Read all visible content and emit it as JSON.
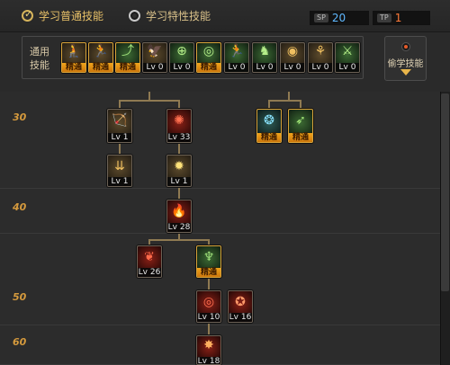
{
  "header": {
    "mode_normal": "学习普通技能",
    "mode_trait": "学习特性技能",
    "sp_tag": "SP",
    "sp_value": "20",
    "tp_tag": "TP",
    "tp_value": "1"
  },
  "common": {
    "label_line1": "通用",
    "label_line2": "技能",
    "mastered_text": "精通",
    "skills": [
      {
        "caption": "精通",
        "mastered": true
      },
      {
        "caption": "精通",
        "mastered": true
      },
      {
        "caption": "精通",
        "mastered": true
      },
      {
        "caption": "Lv 0",
        "mastered": false
      },
      {
        "caption": "Lv 0",
        "mastered": false
      },
      {
        "caption": "精通",
        "mastered": true
      },
      {
        "caption": "Lv 0",
        "mastered": false
      },
      {
        "caption": "Lv 0",
        "mastered": false
      },
      {
        "caption": "Lv 0",
        "mastered": false
      },
      {
        "caption": "Lv 0",
        "mastered": false
      },
      {
        "caption": "Lv 0",
        "mastered": false
      }
    ]
  },
  "side": {
    "label": "偷学技能"
  },
  "levels": [
    "30",
    "40",
    "50",
    "60"
  ],
  "tree": {
    "s1": "Lv 1",
    "s2": "Lv 33",
    "s3": "精通",
    "s4": "精通",
    "s5": "Lv 1",
    "s6": "Lv 1",
    "s7": "Lv 28",
    "s8": "Lv 26",
    "s9": "精通",
    "s10": "Lv 10",
    "s11": "Lv 16",
    "s12": "Lv 18"
  }
}
